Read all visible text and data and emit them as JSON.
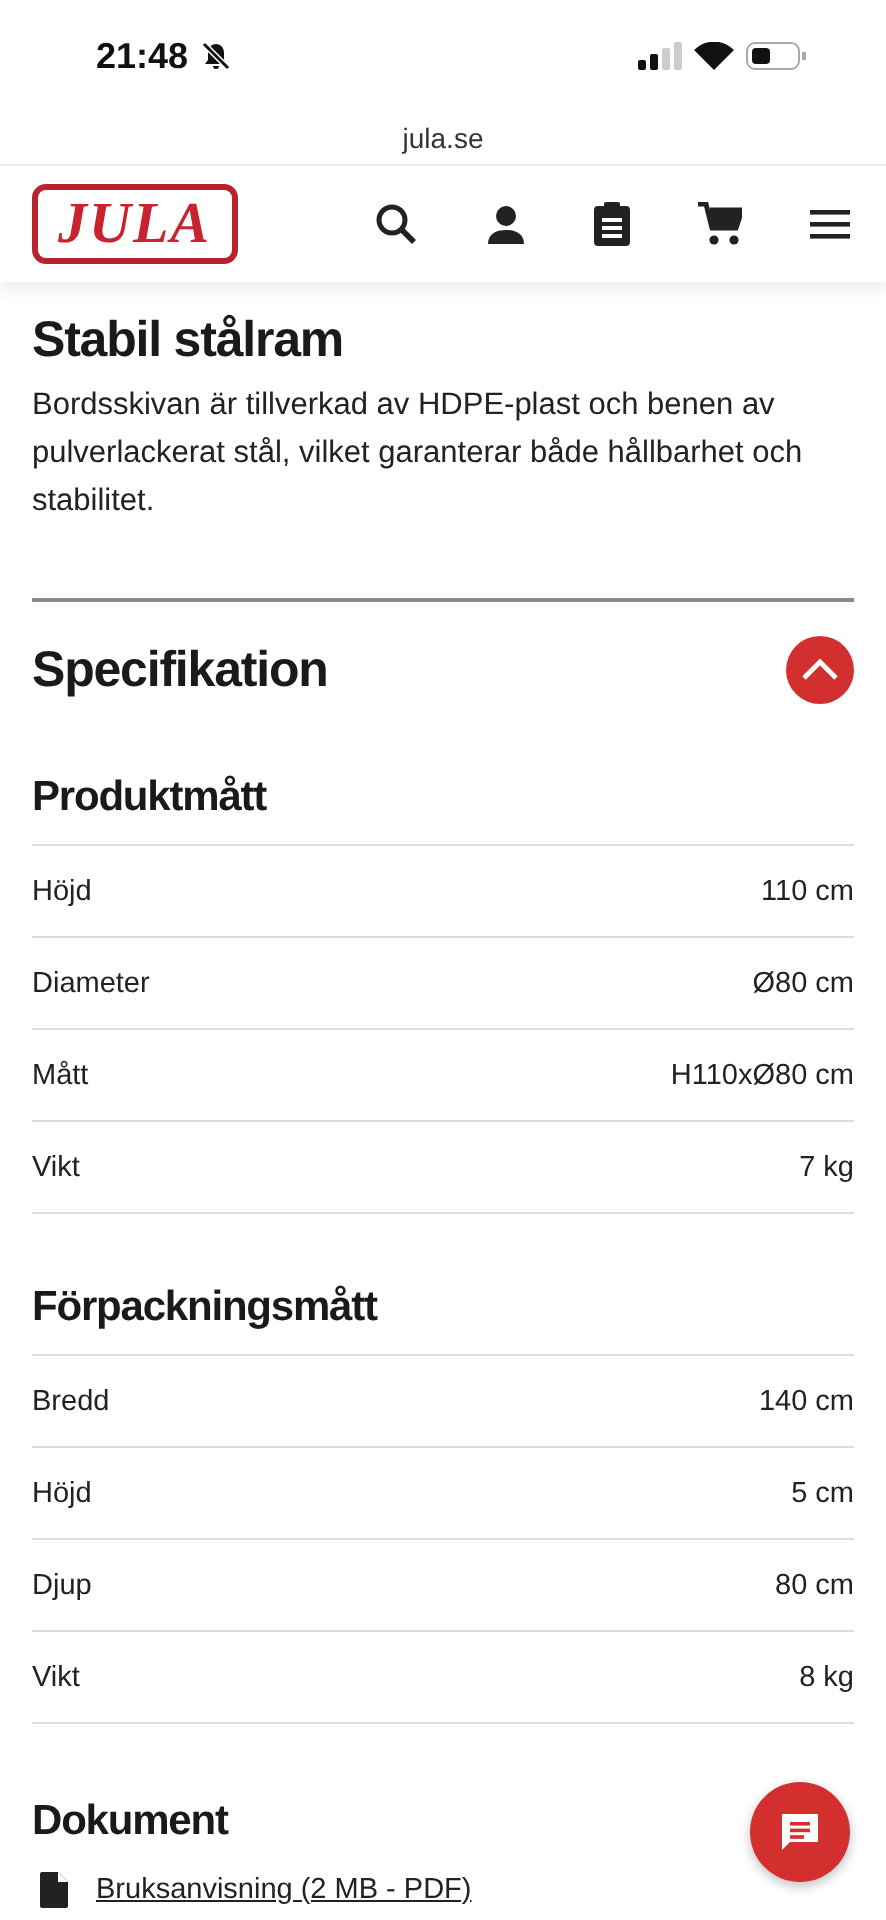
{
  "status_bar": {
    "time": "21:48"
  },
  "browser": {
    "url": "jula.se"
  },
  "header": {
    "logo": "JULA"
  },
  "feature": {
    "title": "Stabil stålram",
    "text": "Bordsskivan är tillverkad av HDPE-plast och benen av pulverlackerat stål, vilket garanterar både hållbarhet och stabilitet."
  },
  "specification": {
    "title": "Specifikation",
    "expanded": true,
    "groups": [
      {
        "title": "Produktmått",
        "rows": [
          {
            "label": "Höjd",
            "value": "110 cm"
          },
          {
            "label": "Diameter",
            "value": "Ø80 cm"
          },
          {
            "label": "Mått",
            "value": "H110xØ80 cm"
          },
          {
            "label": "Vikt",
            "value": "7 kg"
          }
        ]
      },
      {
        "title": "Förpackningsmått",
        "rows": [
          {
            "label": "Bredd",
            "value": "140 cm"
          },
          {
            "label": "Höjd",
            "value": "5 cm"
          },
          {
            "label": "Djup",
            "value": "80 cm"
          },
          {
            "label": "Vikt",
            "value": "8 kg"
          }
        ]
      }
    ]
  },
  "documents": {
    "title": "Dokument",
    "items": [
      {
        "label": "Bruksanvisning (2 MB - PDF)"
      }
    ]
  }
}
